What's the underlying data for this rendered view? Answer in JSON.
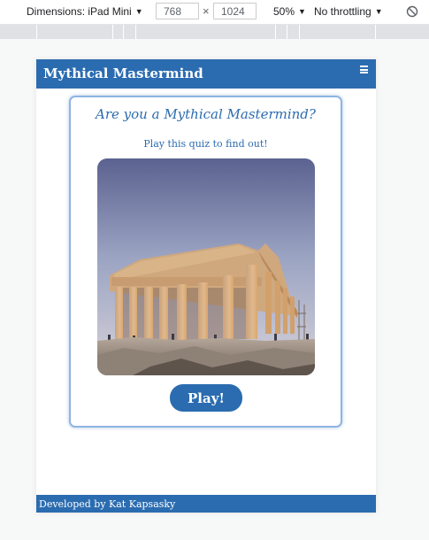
{
  "devtools": {
    "dimensions_label": "Dimensions: iPad Mini",
    "width": "768",
    "times": "×",
    "height": "1024",
    "zoom": "50%",
    "throttling": "No throttling"
  },
  "site": {
    "brand": "Mythical Mastermind",
    "menu_icon": "hamburger-icon"
  },
  "card": {
    "title": "Are you a Mythical Mastermind?",
    "subtitle": "Play this quiz to find out!",
    "image_alt": "Parthenon",
    "play_label": "Play!"
  },
  "footer": {
    "credit": "Developed by Kat Kapsasky"
  },
  "colors": {
    "brand_blue": "#2b6cb0",
    "card_border": "#8eb4e3"
  }
}
